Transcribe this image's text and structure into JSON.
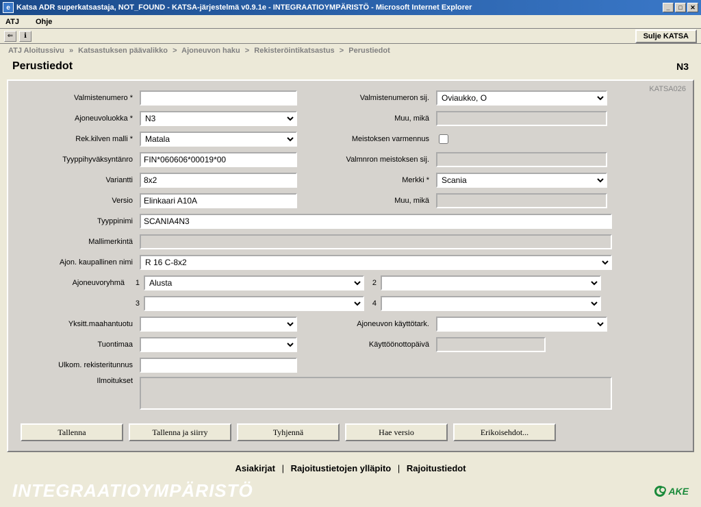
{
  "window": {
    "title": "Katsa ADR superkatsastaja, NOT_FOUND - KATSA-järjestelmä v0.9.1e - INTEGRAATIOYMPÄRISTÖ - Microsoft Internet Explorer"
  },
  "menu": {
    "atj": "ATJ",
    "help": "Ohje"
  },
  "toolbar": {
    "close": "Sulje KATSA"
  },
  "breadcrumb": {
    "items": [
      "ATJ Aloitussivu",
      "Katsastuksen päävalikko",
      "Ajoneuvon haku",
      "Rekisteröintikatsastus",
      "Perustiedot"
    ]
  },
  "heading": {
    "title": "Perustiedot",
    "class_code": "N3"
  },
  "panel_code": "KATSA026",
  "labels": {
    "valmistenumero": "Valmistenumero *",
    "ajoneuvoluokka": "Ajoneuvoluokka *",
    "rekkilven": "Rek.kilven malli *",
    "tyyppihyv": "Tyyppihyväksyntänro",
    "variantti": "Variantti",
    "versio": "Versio",
    "tyyppinimi": "Tyyppinimi",
    "mallimerkinta": "Mallimerkintä",
    "kaupallinen": "Ajon. kaupallinen nimi",
    "ajoneuvoryhma": "Ajoneuvoryhmä",
    "yksitt": "Yksitt.maahantuotu",
    "tuontimaa": "Tuontimaa",
    "ulkom": "Ulkom. rekisteritunnus",
    "ilmoitukset": "Ilmoitukset",
    "valmistenumeron_sij": "Valmistenumeron sij.",
    "muu_mika": "Muu, mikä",
    "meistoksen": "Meistoksen varmennus",
    "valmnron_sij": "Valmnron meistoksen sij.",
    "merkki": "Merkki *",
    "muu_mika2": "Muu, mikä",
    "kayttotark": "Ajoneuvon käyttötark.",
    "kayttoonotto": "Käyttöönottopäivä",
    "g1": "1",
    "g2": "2",
    "g3": "3",
    "g4": "4"
  },
  "values": {
    "valmistenumero": "",
    "ajoneuvoluokka": "N3",
    "rekkilven": "Matala",
    "tyyppihyv": "FIN*060606*00019*00",
    "variantti": "8x2",
    "versio": "Elinkaari A10A",
    "tyyppinimi": "SCANIA4N3",
    "mallimerkinta": "",
    "kaupallinen": "R 16 C-8x2",
    "ajoneuvoryhma1": "Alusta",
    "ajoneuvoryhma2": "",
    "ajoneuvoryhma3": "",
    "ajoneuvoryhma4": "",
    "yksitt": "",
    "tuontimaa": "",
    "ulkom": "",
    "ilmoitukset": "",
    "valmistenumeron_sij": "Oviaukko, O",
    "muu_mika": "",
    "valmnron_sij": "",
    "merkki": "Scania",
    "muu_mika2": "",
    "kayttotark": "",
    "kayttoonotto": ""
  },
  "buttons": {
    "tallenna": "Tallenna",
    "tallenna_siirry": "Tallenna ja siirry",
    "tyhjenna": "Tyhjennä",
    "hae_versio": "Hae versio",
    "erikois": "Erikoisehdot..."
  },
  "links": {
    "asiakirjat": "Asiakirjat",
    "rajoitus_yllapito": "Rajoitustietojen ylläpito",
    "rajoitustiedot": "Rajoitustiedot"
  },
  "footer": {
    "env": "INTEGRAATIOYMPÄRISTÖ",
    "logo": "AKE"
  }
}
